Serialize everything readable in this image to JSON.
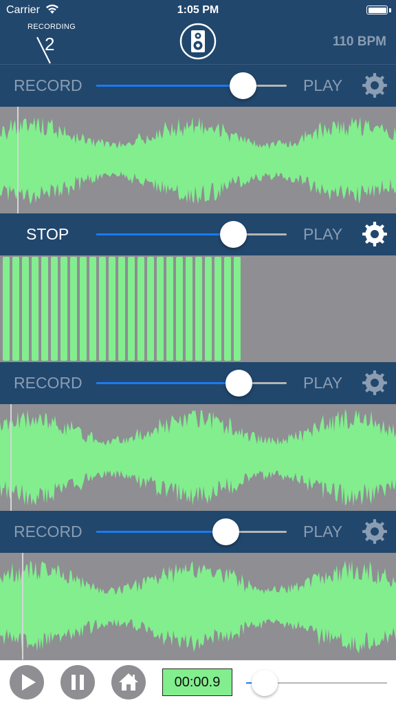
{
  "status_bar": {
    "carrier": "Carrier",
    "time": "1:05 PM"
  },
  "header": {
    "recording_label": "RECORDING",
    "recording_number": "2",
    "bpm": "110 BPM"
  },
  "tracks": [
    {
      "button": "RECORD",
      "play": "PLAY",
      "volume": 0.77,
      "active": false,
      "playhead_fraction": 0.043
    },
    {
      "button": "STOP",
      "play": "PLAY",
      "volume": 0.72,
      "active": true
    },
    {
      "button": "RECORD",
      "play": "PLAY",
      "volume": 0.75,
      "active": false,
      "playhead_fraction": 0.026
    },
    {
      "button": "RECORD",
      "play": "PLAY",
      "volume": 0.68,
      "active": false,
      "playhead_fraction": 0.055
    }
  ],
  "loop_count": 25,
  "footer": {
    "timer": "00:00.9",
    "position": 0.02
  },
  "colors": {
    "header_bg": "#21476d",
    "wave_green": "#82ee8e",
    "wave_bg": "#8e8e93",
    "accent_blue": "#1a7bf5",
    "muted_text": "#8b9db2"
  },
  "icons": {
    "speaker": "speaker-icon",
    "gear": "gear-icon",
    "play": "play-icon",
    "pause": "pause-icon",
    "home": "home-icon",
    "wifi": "wifi-icon",
    "battery": "battery-icon"
  }
}
